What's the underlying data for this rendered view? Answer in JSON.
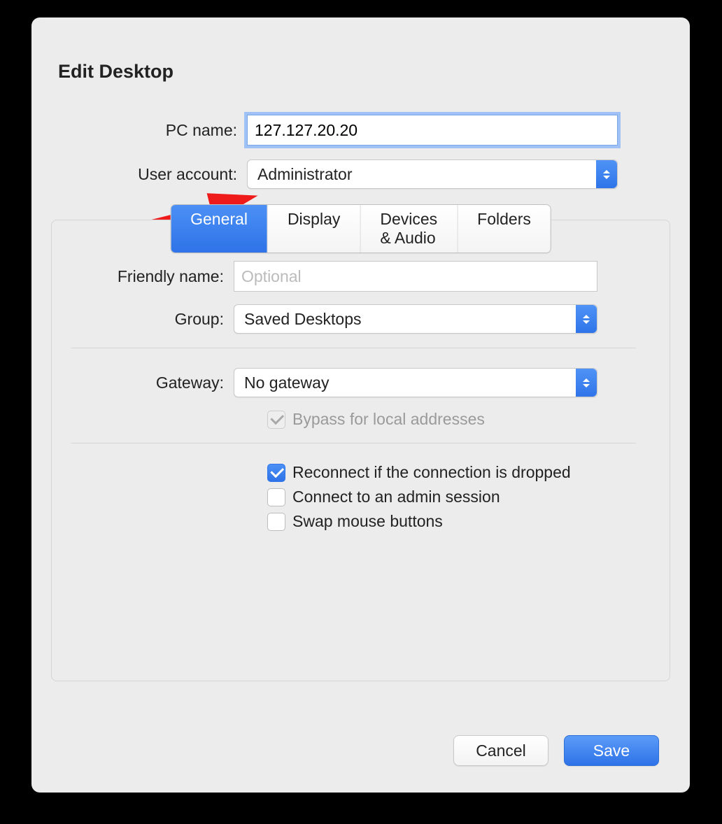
{
  "title": "Edit Desktop",
  "fields": {
    "pc_name_label": "PC name:",
    "pc_name_value": "127.127.20.20",
    "user_account_label": "User account:",
    "user_account_value": "Administrator"
  },
  "tabs": {
    "items": [
      "General",
      "Display",
      "Devices & Audio",
      "Folders"
    ],
    "selected": 0
  },
  "general": {
    "friendly_name_label": "Friendly name:",
    "friendly_name_value": "",
    "friendly_name_placeholder": "Optional",
    "group_label": "Group:",
    "group_value": "Saved Desktops",
    "gateway_label": "Gateway:",
    "gateway_value": "No gateway",
    "bypass_label": "Bypass for local addresses",
    "bypass_checked": true,
    "bypass_disabled": true,
    "reconnect_label": "Reconnect if the connection is dropped",
    "reconnect_checked": true,
    "admin_label": "Connect to an admin session",
    "admin_checked": false,
    "swap_label": "Swap mouse buttons",
    "swap_checked": false
  },
  "buttons": {
    "cancel": "Cancel",
    "save": "Save"
  },
  "colors": {
    "accent": "#2f74e9"
  }
}
